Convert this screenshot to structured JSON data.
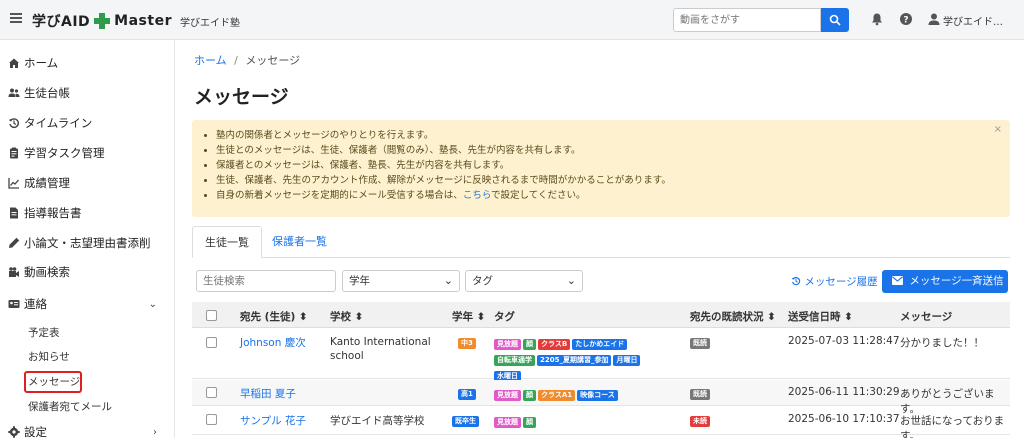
{
  "header": {
    "logo_text_left": "学びAID",
    "logo_text_right": "Master",
    "logo_subtitle": "学びエイド塾",
    "search_placeholder": "動画をさがす",
    "user_name": "学びエイド…"
  },
  "sidebar": {
    "items": [
      {
        "label": "ホーム",
        "icon": "home-icon"
      },
      {
        "label": "生徒台帳",
        "icon": "users-icon"
      },
      {
        "label": "タイムライン",
        "icon": "history-icon"
      },
      {
        "label": "学習タスク管理",
        "icon": "clipboard-icon"
      },
      {
        "label": "成績管理",
        "icon": "chart-icon"
      },
      {
        "label": "指導報告書",
        "icon": "document-icon"
      },
      {
        "label": "小論文・志望理由書添削",
        "icon": "pen-icon"
      },
      {
        "label": "動画検索",
        "icon": "video-icon"
      },
      {
        "label": "連絡",
        "icon": "contact-icon"
      }
    ],
    "sub_items": [
      "予定表",
      "お知らせ",
      "メッセージ",
      "保護者宛てメール"
    ],
    "settings_label": "設定"
  },
  "breadcrumb": {
    "home": "ホーム",
    "separator": "/",
    "current": "メッセージ"
  },
  "page_title": "メッセージ",
  "alert": {
    "lines": [
      "塾内の関係者とメッセージのやりとりを行えます。",
      "生徒とのメッセージは、生徒、保護者（閲覧のみ）、塾長、先生が内容を共有します。",
      "保護者とのメッセージは、保護者、塾長、先生が内容を共有します。",
      "生徒、保護者、先生のアカウント作成、解除がメッセージに反映されるまで時間がかかることがあります。"
    ],
    "last_line_pre": "自身の新着メッセージを定期的にメール受信する場合は、",
    "last_line_link": "こちら",
    "last_line_post": "で設定してください。",
    "close": "×"
  },
  "tabs": {
    "active": "生徒一覧",
    "other": "保護者一覧"
  },
  "filters": {
    "search_placeholder": "生徒検索",
    "grade_label": "学年",
    "tag_label": "タグ",
    "history_link": "メッセージ履歴",
    "bulk_send": "メッセージ一斉送信"
  },
  "table": {
    "headers": [
      "宛先 (生徒) ⬍",
      "学校 ⬍",
      "学年 ⬍",
      "タグ",
      "宛先の既読状況 ⬍",
      "送受信日時 ⬍",
      "メッセージ"
    ],
    "rows": [
      {
        "name": "Johnson 慶次",
        "school": "Kanto International school",
        "grade": "中3",
        "grade_color": "#f08c2c",
        "tags": [
          {
            "label": "見放題",
            "color": "#e05ac8"
          },
          {
            "label": "顔",
            "color": "#36a55a"
          },
          {
            "label": "クラスB",
            "color": "#e43a3a"
          },
          {
            "label": "たしかめエイド",
            "color": "#1a73e8"
          },
          {
            "label": "自転車通学",
            "color": "#36a55a"
          },
          {
            "label": "2205_夏期講習_参加",
            "color": "#1a73e8"
          },
          {
            "label": "月曜日",
            "color": "#1a73e8"
          },
          {
            "label": "水曜日",
            "color": "#1a73e8"
          }
        ],
        "read_status": "既読",
        "read_color": "#777777",
        "datetime": "2025-07-03 11:28:47",
        "message": "分かりました！！"
      },
      {
        "name": "早稲田 夏子",
        "school": "",
        "grade": "高1",
        "grade_color": "#1a73e8",
        "tags": [
          {
            "label": "見放題",
            "color": "#e05ac8"
          },
          {
            "label": "顔",
            "color": "#36a55a"
          },
          {
            "label": "クラスA1",
            "color": "#f08c2c"
          },
          {
            "label": "映像コース",
            "color": "#1a73e8"
          }
        ],
        "read_status": "既読",
        "read_color": "#777777",
        "datetime": "2025-06-11 11:30:29",
        "message": "ありがとうございます。"
      },
      {
        "name": "サンプル 花子",
        "school": "学びエイド高等学校",
        "grade": "既卒生",
        "grade_color": "#1a73e8",
        "tags": [
          {
            "label": "見放題",
            "color": "#e05ac8"
          },
          {
            "label": "顔",
            "color": "#36a55a"
          }
        ],
        "read_status": "未読",
        "read_color": "#e43a3a",
        "datetime": "2025-06-10 17:10:37",
        "message": "お世話になっております。"
      }
    ]
  },
  "colors": {
    "accent": "#1a73e8",
    "alert_bg": "#fdf1cf",
    "highlight": "#e02020"
  }
}
